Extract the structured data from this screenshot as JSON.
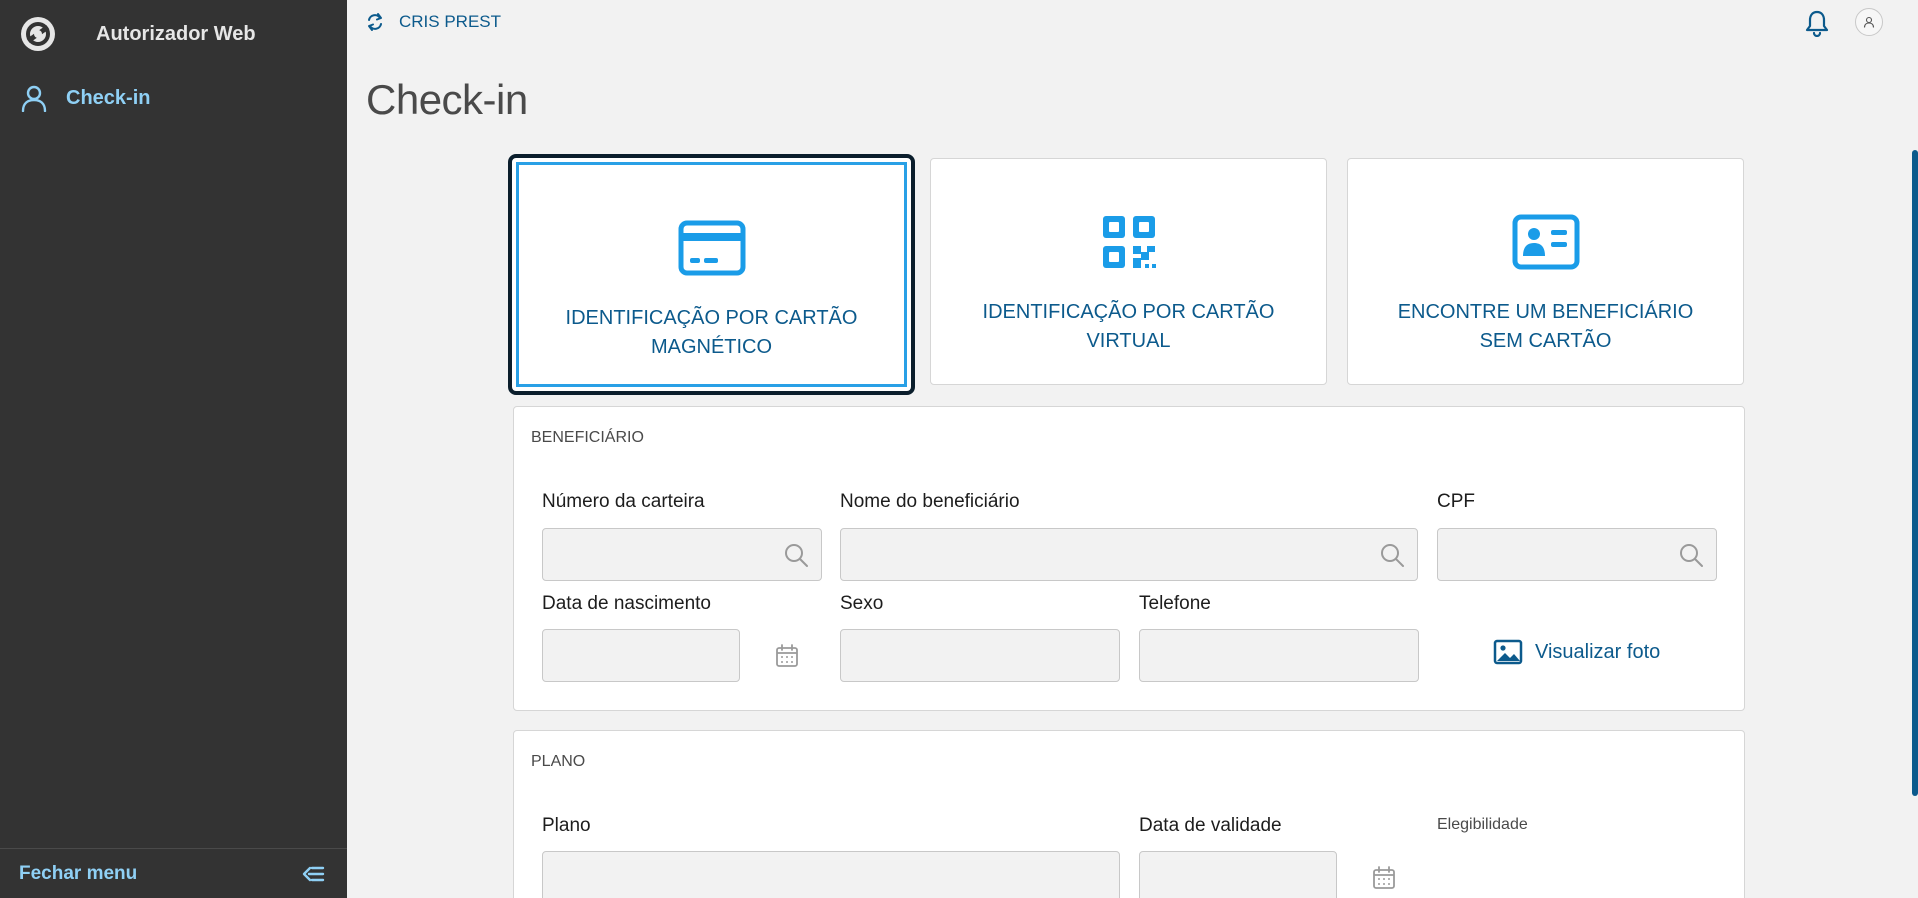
{
  "app": {
    "title": "Autorizador Web"
  },
  "sidebar": {
    "items": [
      {
        "label": "Check-in",
        "icon": "user-icon"
      }
    ],
    "footer_label": "Fechar menu"
  },
  "topbar": {
    "provider": "CRIS PREST"
  },
  "page": {
    "title": "Check-in"
  },
  "cards": [
    {
      "label": "IDENTIFICAÇÃO POR CARTÃO MAGNÉTICO",
      "icon": "credit-card-icon",
      "selected": true
    },
    {
      "label": "IDENTIFICAÇÃO POR CARTÃO VIRTUAL",
      "icon": "qr-code-icon",
      "selected": false
    },
    {
      "label": "ENCONTRE UM BENEFICIÁRIO SEM CARTÃO",
      "icon": "id-card-icon",
      "selected": false
    }
  ],
  "beneficiario": {
    "title": "BENEFICIÁRIO",
    "numero_carteira": {
      "label": "Número da carteira",
      "value": ""
    },
    "nome": {
      "label": "Nome do beneficiário",
      "value": ""
    },
    "cpf": {
      "label": "CPF",
      "value": ""
    },
    "data_nascimento": {
      "label": "Data de nascimento",
      "value": ""
    },
    "sexo": {
      "label": "Sexo",
      "value": ""
    },
    "telefone": {
      "label": "Telefone",
      "value": ""
    },
    "foto_link": "Visualizar foto"
  },
  "plano": {
    "title": "PLANO",
    "plano": {
      "label": "Plano",
      "value": ""
    },
    "data_validade": {
      "label": "Data de validade",
      "value": ""
    },
    "elegibilidade": {
      "label": "Elegibilidade"
    }
  },
  "colors": {
    "sidebar": "#333333",
    "accent": "#0c5a8c",
    "highlight": "#29a0e6",
    "sidebar_text": "#8fd0f5"
  }
}
